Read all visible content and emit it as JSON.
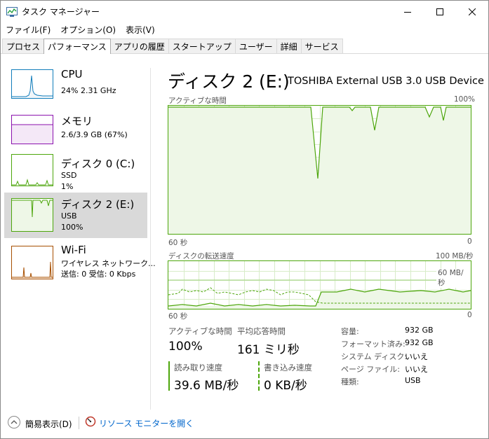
{
  "window": {
    "title": "タスク マネージャー"
  },
  "menu": [
    "ファイル(F)",
    "オプション(O)",
    "表示(V)"
  ],
  "tabs": [
    "プロセス",
    "パフォーマンス",
    "アプリの履歴",
    "スタートアップ",
    "ユーザー",
    "詳細",
    "サービス"
  ],
  "active_tab": "パフォーマンス",
  "devices": [
    {
      "name": "CPU",
      "lines": [
        "24%  2.31 GHz"
      ],
      "color": "#117dbb"
    },
    {
      "name": "メモリ",
      "lines": [
        "2.6/3.9 GB (67%)"
      ],
      "color": "#8b12ae"
    },
    {
      "name": "ディスク 0 (C:)",
      "lines": [
        "SSD",
        "1%"
      ],
      "color": "#4da60c"
    },
    {
      "name": "ディスク 2 (E:)",
      "lines": [
        "USB",
        "100%"
      ],
      "color": "#4da60c",
      "selected": true
    },
    {
      "name": "Wi-Fi",
      "lines": [
        "ワイヤレス ネットワーク...",
        "送信: 0  受信: 0 Kbps"
      ],
      "color": "#a74f01"
    }
  ],
  "detail": {
    "heading": "ディスク 2 (E:)",
    "device_name": "TOSHIBA External USB 3.0 USB Device",
    "active_graph": {
      "label": "アクティブな時間",
      "max_label": "100%",
      "time_label": "60 秒",
      "min_label": "0"
    },
    "transfer_graph": {
      "label": "ディスクの転送速度",
      "max_label": "100 MB/秒",
      "mid_label": "60 MB/秒",
      "time_label": "60 秒",
      "min_label": "0"
    },
    "stats": {
      "active_time_label": "アクティブな時間",
      "active_time_value": "100%",
      "avg_response_label": "平均応答時間",
      "avg_response_value": "161 ミリ秒",
      "read_label": "読み取り速度",
      "read_value": "39.6 MB/秒",
      "write_label": "書き込み速度",
      "write_value": "0 KB/秒"
    },
    "info": [
      {
        "key": "容量:",
        "value": "932 GB"
      },
      {
        "key": "フォーマット済み:",
        "value": "932 GB"
      },
      {
        "key": "システム ディスク:",
        "value": "いいえ"
      },
      {
        "key": "ページ ファイル:",
        "value": "いいえ"
      },
      {
        "key": "種類:",
        "value": "USB"
      }
    ]
  },
  "footer": {
    "fewer_details": "簡易表示(D)",
    "resource_monitor": "リソース モニターを開く"
  },
  "colors": {
    "disk": "#4da60c",
    "disk_fill": "#eef7e7",
    "grid": "#d8ecc9",
    "link": "#0066cc",
    "selected": "#d9d9d9"
  }
}
